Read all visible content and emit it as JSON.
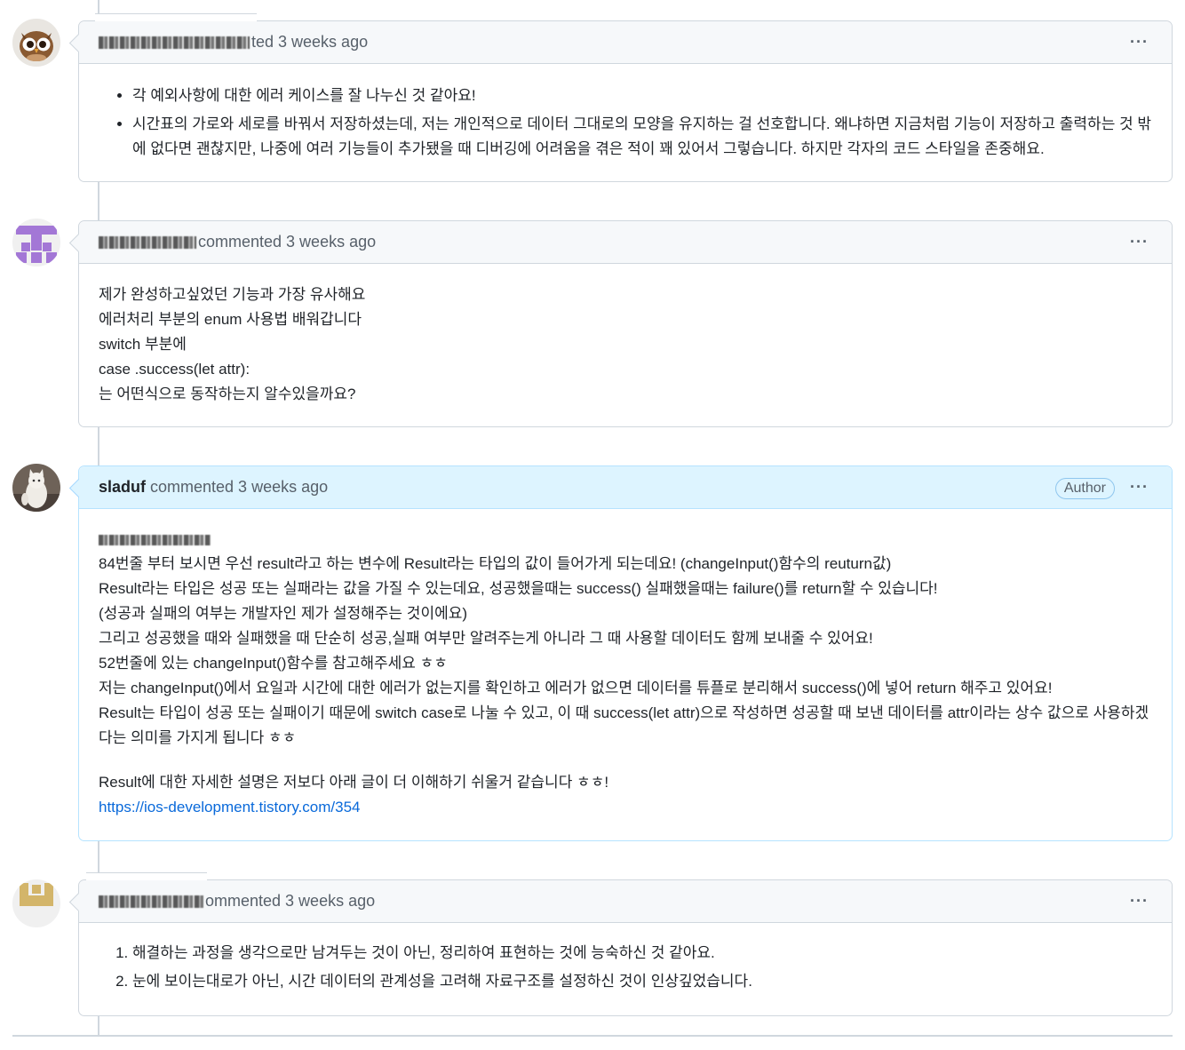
{
  "comments": [
    {
      "verb": "ted 3 weeks ago",
      "more": "···",
      "items": [
        "각 예외사항에 대한 에러 케이스를 잘 나누신 것 같아요!",
        "시간표의 가로와 세로를 바꿔서 저장하셨는데, 저는 개인적으로 데이터 그대로의 모양을 유지하는 걸 선호합니다. 왜냐하면 지금처럼 기능이 저장하고 출력하는 것 밖에 없다면 괜찮지만, 나중에 여러 기능들이 추가됐을 때 디버깅에 어려움을 겪은 적이 꽤 있어서 그렇습니다. 하지만 각자의 코드 스타일을 존중해요."
      ]
    },
    {
      "verb": "commented 3 weeks ago",
      "more": "···",
      "lines": [
        "제가 완성하고싶었던 기능과 가장 유사해요",
        "에러처리 부분의 enum 사용법 배워갑니다",
        "switch 부분에",
        "case .success(let attr):",
        "는 어떤식으로 동작하는지 알수있을까요?"
      ]
    },
    {
      "username": "sladuf",
      "verb": "commented 3 weeks ago",
      "badge": "Author",
      "more": "···",
      "lines": [
        "84번줄 부터 보시면 우선 result라고 하는 변수에 Result라는 타입의 값이 들어가게 되는데요! (changeInput()함수의 reuturn값)",
        "Result라는 타입은 성공 또는 실패라는 값을 가질 수 있는데요, 성공했을때는 success() 실패했을때는 failure()를 return할 수 있습니다!",
        "(성공과 실패의 여부는 개발자인 제가 설정해주는 것이에요)",
        "그리고 성공했을 때와 실패했을 때 단순히 성공,실패 여부만 알려주는게 아니라 그 때 사용할 데이터도 함께 보내줄 수 있어요!",
        "52번줄에 있는 changeInput()함수를 참고해주세요 ㅎㅎ",
        "저는 changeInput()에서 요일과 시간에 대한 에러가 없는지를 확인하고 에러가 없으면 데이터를 튜플로 분리해서 success()에 넣어 return 해주고 있어요!",
        "Result는 타입이 성공 또는 실패이기 때문에 switch case로 나눌 수 있고, 이 때 success(let attr)으로 작성하면 성공할 때 보낸 데이터를 attr이라는 상수 값으로 사용하겠다는 의미를 가지게 됩니다 ㅎㅎ"
      ],
      "closing": "Result에 대한 자세한 설명은 저보다 아래 글이 더 이해하기 쉬울거 같습니다 ㅎㅎ!",
      "link": "https://ios-development.tistory.com/354"
    },
    {
      "verb": "ommented 3 weeks ago",
      "more": "···",
      "items": [
        "해결하는 과정을 생각으로만 남겨두는 것이 아닌, 정리하여 표현하는 것에 능숙하신 것 같아요.",
        "눈에 보이는대로가 아닌, 시간 데이터의 관계성을 고려해 자료구조를 설정하신 것이 인상깊었습니다."
      ]
    }
  ]
}
